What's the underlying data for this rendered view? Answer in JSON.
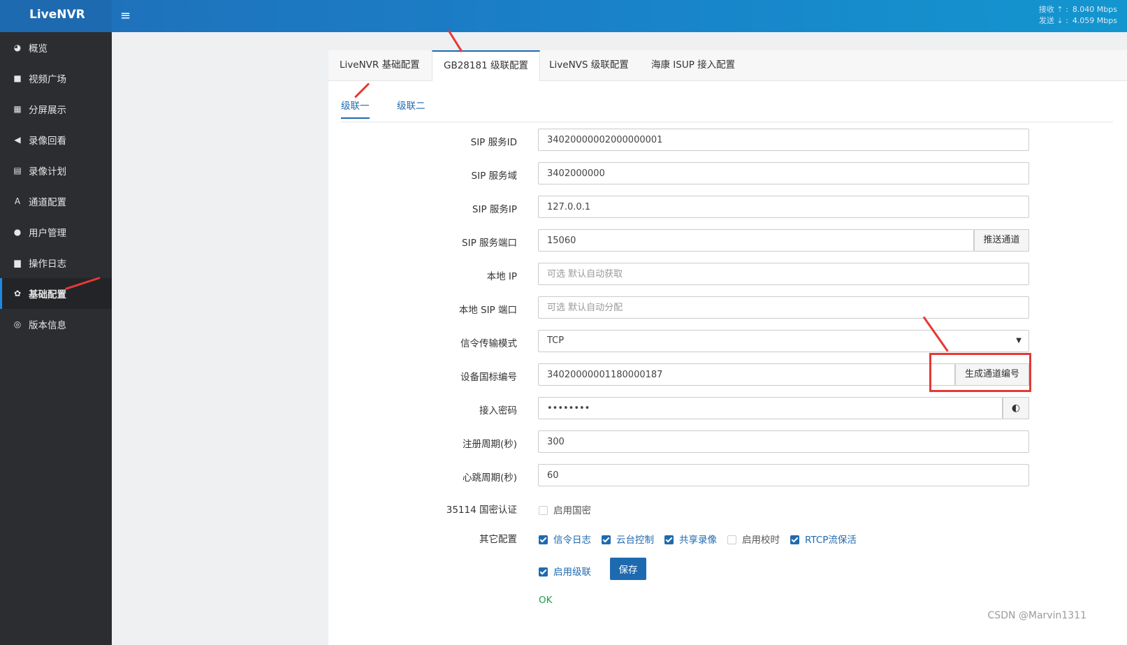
{
  "app": {
    "logo": "LiveNVR",
    "menu_icon": "≡"
  },
  "net": {
    "recv_label": "接收 ⇡ :",
    "recv_value": "8.040 Mbps",
    "send_label": "发送 ⇣ :",
    "send_value": "4.059 Mbps"
  },
  "sidebar": {
    "items": [
      {
        "label": "概览",
        "icon": "dashboard-icon",
        "glyph": "◕"
      },
      {
        "label": "视频广场",
        "icon": "video-camera-icon",
        "glyph": "■"
      },
      {
        "label": "分屏展示",
        "icon": "grid-icon",
        "glyph": "▦"
      },
      {
        "label": "录像回看",
        "icon": "backward-icon",
        "glyph": "◀"
      },
      {
        "label": "录像计划",
        "icon": "calendar-icon",
        "glyph": "▤"
      },
      {
        "label": "通道配置",
        "icon": "channel-icon",
        "glyph": "A"
      },
      {
        "label": "用户管理",
        "icon": "users-icon",
        "glyph": "●"
      },
      {
        "label": "操作日志",
        "icon": "file-icon",
        "glyph": "▆"
      },
      {
        "label": "基础配置",
        "icon": "gears-icon",
        "glyph": "✿"
      },
      {
        "label": "版本信息",
        "icon": "lifebuoy-icon",
        "glyph": "◎"
      }
    ],
    "active_index": 8
  },
  "tabs": [
    {
      "label": "LiveNVR 基础配置"
    },
    {
      "label": "GB28181 级联配置"
    },
    {
      "label": "LiveNVS 级联配置"
    },
    {
      "label": "海康 ISUP 接入配置"
    }
  ],
  "subtabs": [
    {
      "label": "级联一"
    },
    {
      "label": "级联二"
    }
  ],
  "form": {
    "sip_id": {
      "label": "SIP 服务ID",
      "value": "34020000002000000001"
    },
    "sip_domain": {
      "label": "SIP 服务域",
      "value": "3402000000"
    },
    "sip_ip": {
      "label": "SIP 服务IP",
      "value": "127.0.0.1"
    },
    "sip_port": {
      "label": "SIP 服务端口",
      "value": "15060",
      "button": "推送通道"
    },
    "local_ip": {
      "label": "本地 IP",
      "placeholder": "可选 默认自动获取"
    },
    "local_sip_port": {
      "label": "本地 SIP 端口",
      "placeholder": "可选 默认自动分配"
    },
    "transport": {
      "label": "信令传输模式",
      "value": "TCP"
    },
    "device_id": {
      "label": "设备国标编号",
      "value": "34020000001180000187",
      "button": "生成通道编号"
    },
    "password": {
      "label": "接入密码",
      "value": "••••••••"
    },
    "register_period": {
      "label": "注册周期(秒)",
      "value": "300"
    },
    "heartbeat_period": {
      "label": "心跳周期(秒)",
      "value": "60"
    },
    "gm_auth": {
      "label": "35114 国密认证",
      "option": "启用国密"
    },
    "other": {
      "label": "其它配置",
      "options": [
        {
          "label": "信令日志",
          "checked": true
        },
        {
          "label": "云台控制",
          "checked": true
        },
        {
          "label": "共享录像",
          "checked": true
        },
        {
          "label": "启用校时",
          "checked": false
        },
        {
          "label": "RTCP流保活",
          "checked": true
        }
      ]
    },
    "enable_cascade": {
      "label": "启用级联",
      "checked": true
    },
    "save": "保存",
    "status": "OK"
  },
  "watermark": "CSDN @Marvin1311",
  "colors": {
    "primary": "#1e6ab0",
    "annotation": "#e53935",
    "success": "#1aa34a"
  }
}
